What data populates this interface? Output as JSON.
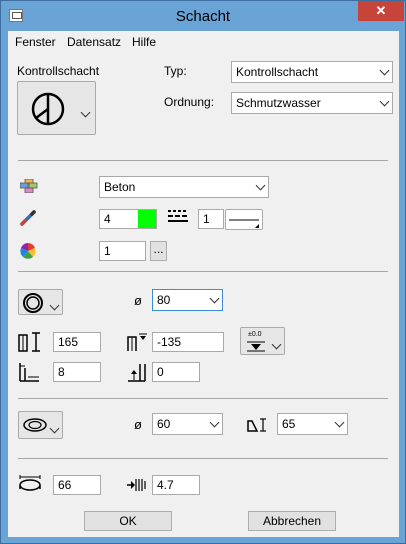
{
  "window": {
    "title": "Schacht",
    "close_glyph": "✕"
  },
  "menu": {
    "items": [
      "Fenster",
      "Datensatz",
      "Hilfe"
    ]
  },
  "header": {
    "schacht_type_label": "Kontrollschacht",
    "typ_label": "Typ:",
    "typ_value": "Kontrollschacht",
    "ordnung_label": "Ordnung:",
    "ordnung_value": "Schmutzwasser"
  },
  "material": {
    "material_value": "Beton",
    "pen_value": "4",
    "pen_color": "#00ff00",
    "line_value": "1",
    "fill_value": "1",
    "more_label": "..."
  },
  "shaft": {
    "diameter_value": "80",
    "height_value": "165",
    "elevation_value": "-135",
    "elevation_button_label": "±0.0",
    "wall_value": "8",
    "bottom_value": "0"
  },
  "cover": {
    "diameter_value": "60",
    "height_value": "65"
  },
  "frame": {
    "size_value": "66",
    "thickness_value": "4.7"
  },
  "buttons": {
    "ok": "OK",
    "cancel": "Abbrechen"
  }
}
